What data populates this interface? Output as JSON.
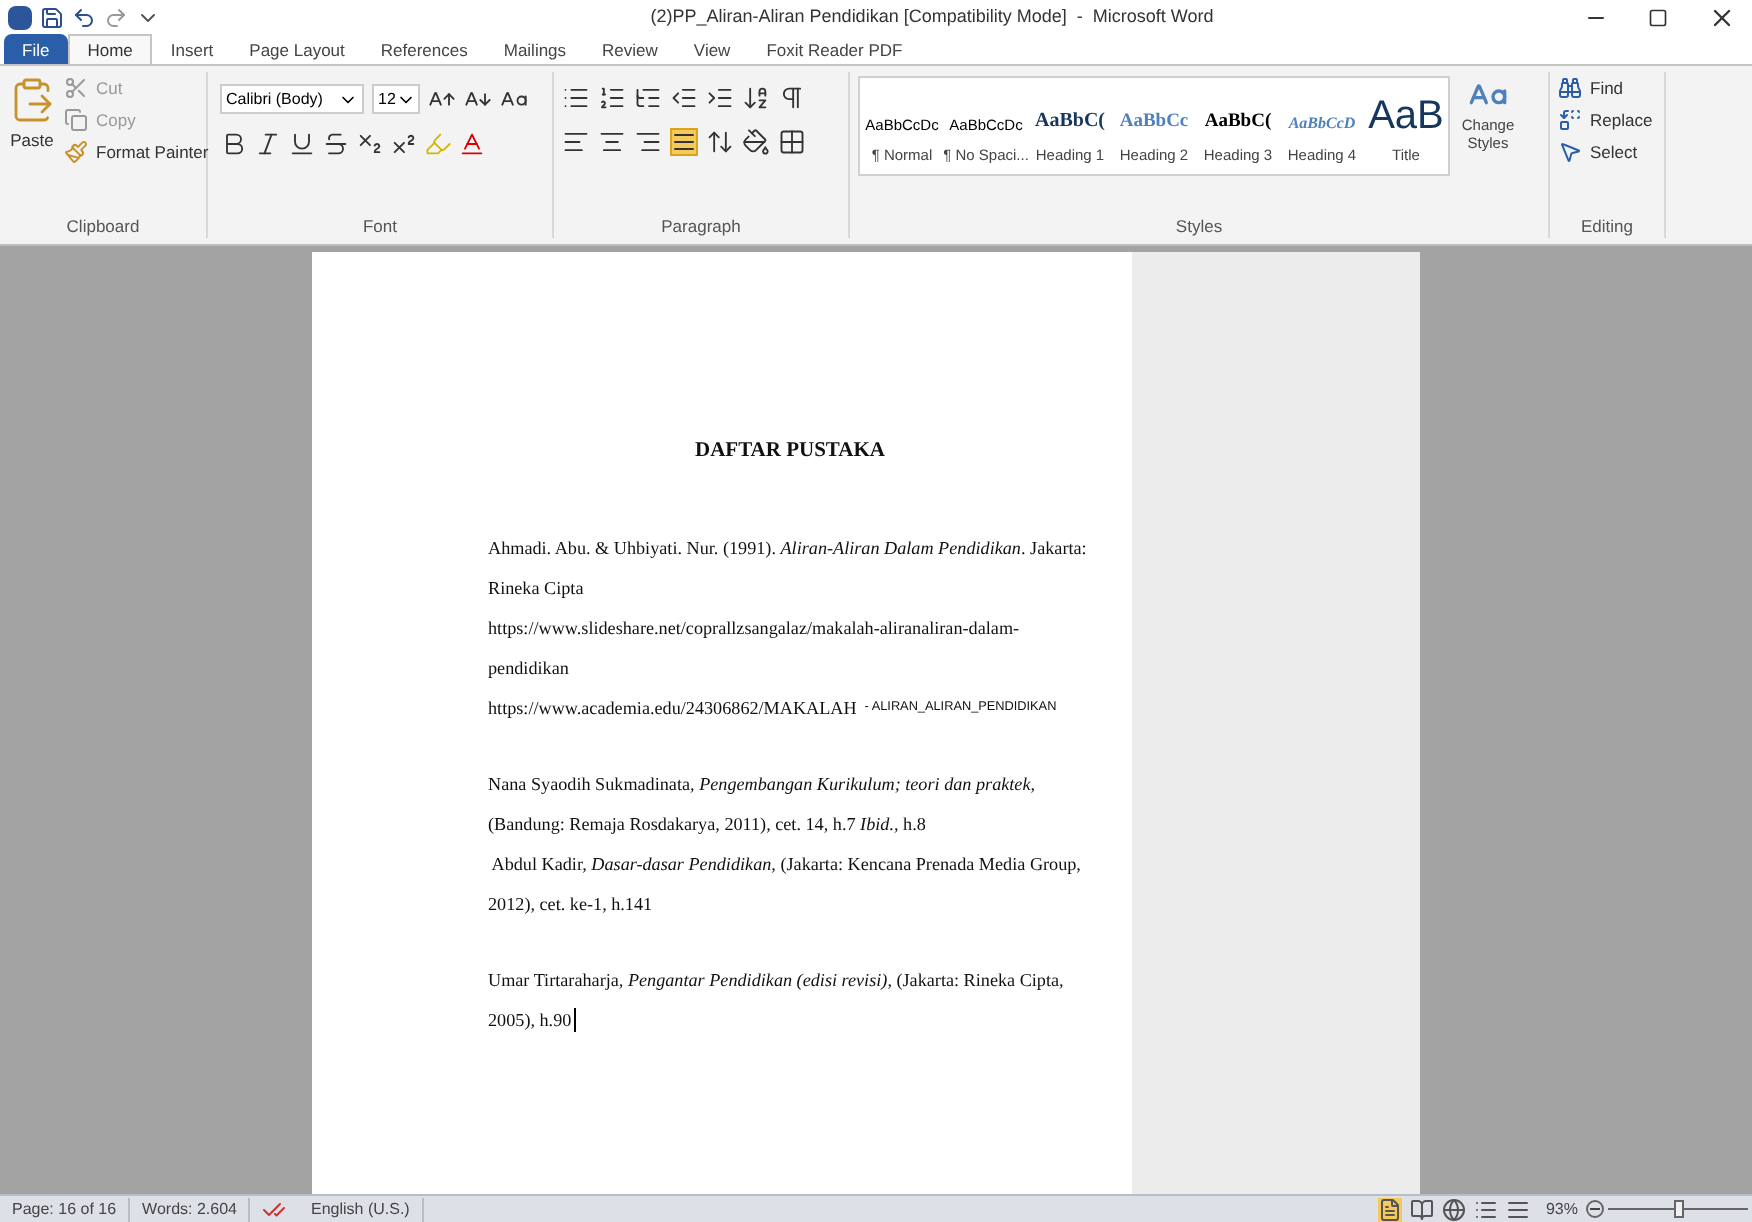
{
  "window": {
    "title": "(2)PP_Aliran-Aliran Pendidikan [Compatibility Mode]  -  Microsoft Word"
  },
  "tabs": [
    {
      "label": "File",
      "kind": "file",
      "selected": false
    },
    {
      "label": "Home",
      "kind": "tab",
      "selected": true
    },
    {
      "label": "Insert",
      "kind": "tab",
      "selected": false
    },
    {
      "label": "Page Layout",
      "kind": "tab",
      "selected": false
    },
    {
      "label": "References",
      "kind": "tab",
      "selected": false
    },
    {
      "label": "Mailings",
      "kind": "tab",
      "selected": false
    },
    {
      "label": "Review",
      "kind": "tab",
      "selected": false
    },
    {
      "label": "View",
      "kind": "tab",
      "selected": false
    },
    {
      "label": "Foxit Reader PDF",
      "kind": "tab",
      "selected": false
    }
  ],
  "clipboard": {
    "label": "Clipboard",
    "paste": "Paste",
    "cut": "Cut",
    "copy": "Copy",
    "format_painter": "Format Painter"
  },
  "font": {
    "label": "Font",
    "name": "Calibri (Body)",
    "size": "12"
  },
  "paragraph": {
    "label": "Paragraph"
  },
  "styles": {
    "label": "Styles",
    "change_styles": "Change Styles",
    "items": [
      {
        "preview": "AaBbCcDc",
        "name": "¶ Normal",
        "selected": false
      },
      {
        "preview": "AaBbCcDc",
        "name": "¶ No Spaci...",
        "selected": false
      },
      {
        "preview": "AaBbC(",
        "name": "Heading 1",
        "selected": false
      },
      {
        "preview": "AaBbCc",
        "name": "Heading 2",
        "selected": false
      },
      {
        "preview": "AaBbC(",
        "name": "Heading 3",
        "selected": false
      },
      {
        "preview": "AaBbCcD",
        "name": "Heading 4",
        "selected": false
      },
      {
        "preview": "AaB",
        "name": "Title",
        "selected": false
      }
    ]
  },
  "editing": {
    "label": "Editing",
    "find": "Find",
    "replace": "Replace",
    "select": "Select"
  },
  "document": {
    "heading": "DAFTAR PUSTAKA",
    "sections": [
      {
        "paragraphs": [
          {
            "lines": [
              "Ahmadi. Abu. & Uhbiyati. Nur. (1991). *Aliran-Aliran Dalam Pendidikan*. Jakarta:",
              "Rineka Cipta"
            ]
          },
          {
            "lines": [
              "https://www.slideshare.net/coprallzsangalaz/makalah-aliranaliran-dalam-",
              "pendidikan"
            ]
          },
          {
            "lines": [
              "https://www.academia.edu/24306862/MAKALAH"
            ],
            "tail": "- ALIRAN_ALIRAN_PENDIDIKAN"
          }
        ]
      },
      {
        "paragraphs": [
          {
            "lines": [
              "Nana Syaodih Sukmadinata, *Pengembangan Kurikulum; teori dan praktek*,",
              "(Bandung: Remaja Rosdakarya, 2011), cet. 14, h.7 *Ibid.*, h.8"
            ]
          },
          {
            "lines": [
              " Abdul Kadir, *Dasar-dasar Pendidikan*, (Jakarta: Kencana Prenada Media Group,",
              "2012), cet. ke-1, h.141"
            ]
          }
        ]
      },
      {
        "paragraphs": [
          {
            "cursor": true,
            "lines": [
              "Umar Tirtaraharja, *Pengantar Pendidikan (edisi revisi)*, (Jakarta: Rineka Cipta,",
              "2005), h.90"
            ]
          }
        ]
      }
    ]
  },
  "status_bar": {
    "page": "Page: 16 of 16",
    "words": "Words: 2.604",
    "language": "English (U.S.)",
    "zoom": "93%",
    "zoom_level": {
      "level": 0.5
    }
  }
}
